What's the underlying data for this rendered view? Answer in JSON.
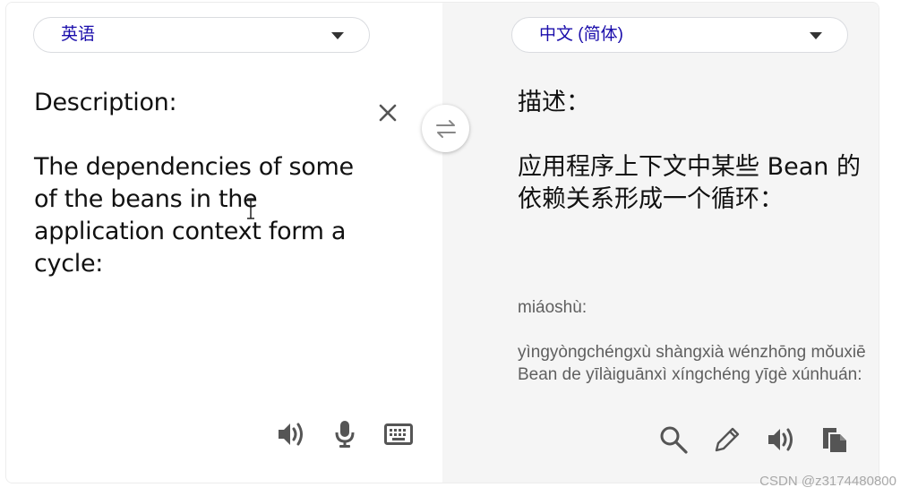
{
  "source": {
    "language": "英语",
    "text": "Description:\n\nThe dependencies of some of the beans in the application context form a cycle:"
  },
  "target": {
    "language": "中文 (简体)",
    "text": "描述：\n\n应用程序上下文中某些 Bean 的依赖关系形成一个循环：",
    "pinyin": "miáoshù:\n\nyìngyòngchéngxù shàngxià wénzhōng mǒuxiē Bean de yīlàiguānxì xíngchéng yīgè xúnhuán:"
  },
  "icons": {
    "clear": "close-icon",
    "swap": "swap-icon",
    "source_tools": [
      "speaker-icon",
      "microphone-icon",
      "keyboard-icon"
    ],
    "target_tools": [
      "search-icon",
      "pencil-icon",
      "speaker-icon",
      "copy-icon"
    ]
  },
  "colors": {
    "language_label": "#1a0dab",
    "pinyin": "#5f5f5f",
    "right_pane_bg": "#f5f5f5"
  },
  "watermark": "CSDN @z3174480800"
}
